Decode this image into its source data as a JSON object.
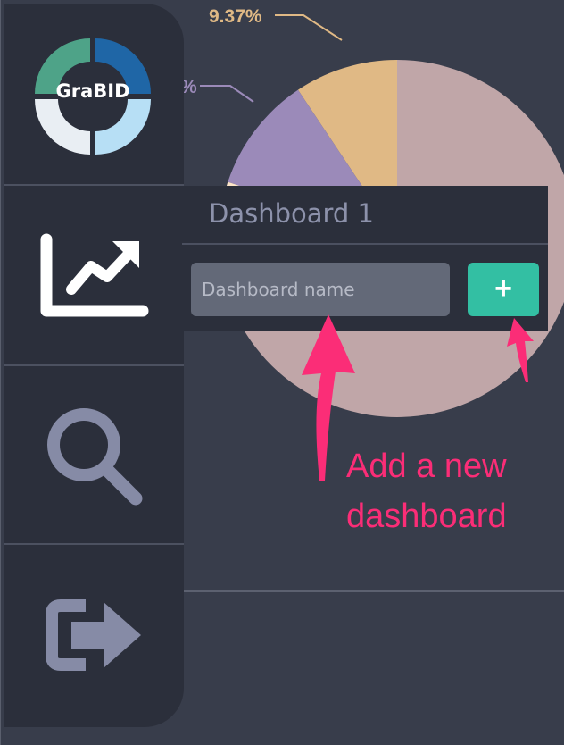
{
  "app": {
    "logo_text": "GraBID"
  },
  "sidebar": {
    "items": [
      {
        "name": "analytics",
        "icon": "chart-trend-icon"
      },
      {
        "name": "search",
        "icon": "search-icon"
      },
      {
        "name": "logout",
        "icon": "logout-icon"
      }
    ]
  },
  "dashboard_panel": {
    "title": "Dashboard 1",
    "input_placeholder": "Dashboard name",
    "add_button_label": "+"
  },
  "annotation": {
    "line1": "Add a new",
    "line2": "dashboard"
  },
  "chart_data": {
    "type": "pie",
    "slices": [
      {
        "label": "9.37%",
        "value": 9.37,
        "color": "#e0b985"
      },
      {
        "label": "%",
        "value": 10.5,
        "color": "#9b8ab9"
      },
      {
        "label": "",
        "value": 4.0,
        "color": "#fde5c8"
      },
      {
        "label": "",
        "value": 4.0,
        "color": "#e66b6b"
      },
      {
        "label": "",
        "value": 72.13,
        "color": "#c0a6a8"
      }
    ],
    "label_colors": {
      "9.37%": "#e0b985",
      "%": "#9b8ab9"
    }
  },
  "colors": {
    "background": "#383d4b",
    "sidebar": "#2b2f3b",
    "accent": "#33bfa3",
    "annotation": "#fb2d77"
  }
}
